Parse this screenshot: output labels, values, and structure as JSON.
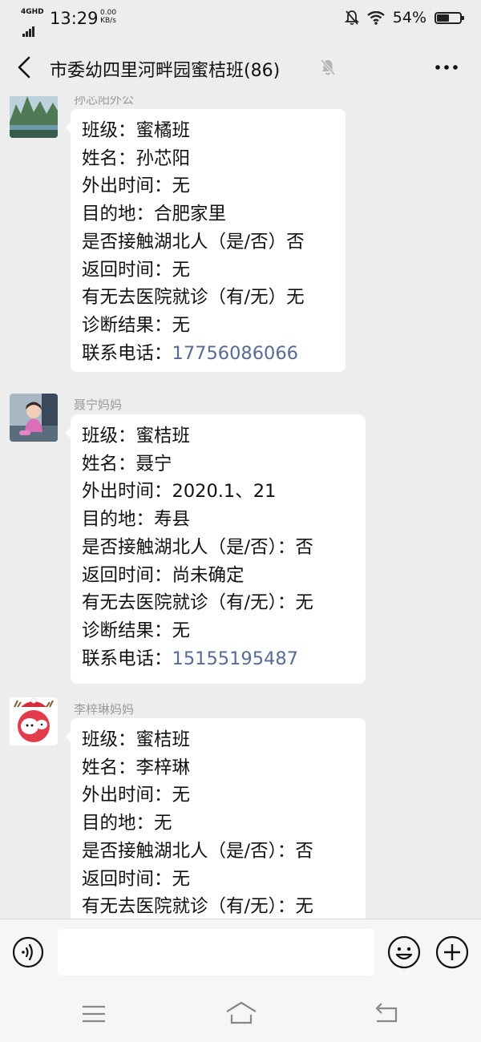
{
  "status_bar": {
    "network": "4GHD",
    "time": "13:29",
    "speed_value": "0.00",
    "speed_unit": "KB/s",
    "battery_percent": "54%",
    "battery_level": 0.54
  },
  "header": {
    "title": "市委幼四里河畔园蜜桔班(86)"
  },
  "messages": [
    {
      "sender": "孙芯阳外公",
      "lines": [
        "班级：蜜橘班",
        "姓名：孙芯阳",
        "外出时间：无",
        "目的地：合肥家里",
        "是否接触湖北人（是/否）否",
        "返回时间：无",
        "有无去医院就诊（有/无）无",
        "诊断结果：无"
      ],
      "phone_label": "联系电话：",
      "phone": "17756086066"
    },
    {
      "sender": "聂宁妈妈",
      "lines": [
        "班级：蜜桔班",
        "姓名：聂宁",
        "外出时间：2020.1、21",
        "目的地：寿县",
        "是否接触湖北人（是/否）：否",
        "返回时间：尚未确定",
        "有无去医院就诊（有/无）：无",
        "诊断结果：无"
      ],
      "phone_label": "联系电话：",
      "phone": "15155195487"
    },
    {
      "sender": "李梓琳妈妈",
      "lines": [
        "班级：蜜桔班",
        "姓名：李梓琳",
        "外出时间：无",
        "目的地：无",
        "是否接触湖北人（是/否）：否",
        "返回时间：无",
        "有无去医院就诊（有/无）：无"
      ]
    }
  ],
  "input": {
    "value": ""
  },
  "colors": {
    "background": "#ededed",
    "bubble": "#ffffff",
    "link": "#576b95"
  }
}
